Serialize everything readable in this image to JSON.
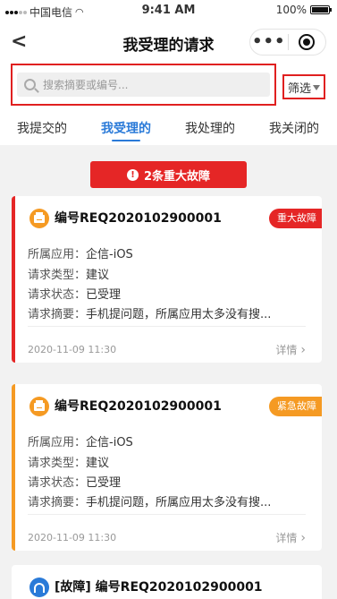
{
  "status": {
    "carrier": "中国电信",
    "time": "9:41 AM",
    "battery": "100%"
  },
  "nav": {
    "title": "我受理的请求",
    "back": "<"
  },
  "search": {
    "placeholder": "搜索摘要或编号...",
    "filter_label": "筛选"
  },
  "tabs": [
    {
      "label": "我提交的"
    },
    {
      "label": "我受理的"
    },
    {
      "label": "我处理的"
    },
    {
      "label": "我关闭的"
    }
  ],
  "alert": {
    "label": "2条重大故障",
    "icon_text": "!"
  },
  "field_labels": {
    "app": "所属应用：",
    "type": "请求类型：",
    "status": "请求状态：",
    "summary": "请求摘要："
  },
  "cards": [
    {
      "title": "编号REQ2020102900001",
      "tag": "重大故障",
      "tag_color": "#e52626",
      "stripe_color": "#e52626",
      "app": "企信-iOS",
      "type": "建议",
      "status": "已受理",
      "summary": "手机提问题，所属应用太多没有搜...",
      "date": "2020-11-09  11:30",
      "detail": "详情"
    },
    {
      "title": "编号REQ2020102900001",
      "tag": "紧急故障",
      "tag_color": "#f59a23",
      "stripe_color": "#f59a23",
      "app": "企信-iOS",
      "type": "建议",
      "status": "已受理",
      "summary": "手机提问题，所属应用太多没有搜...",
      "date": "2020-11-09  11:30",
      "detail": "详情"
    },
    {
      "title": "[故障] 编号REQ2020102900001"
    }
  ]
}
